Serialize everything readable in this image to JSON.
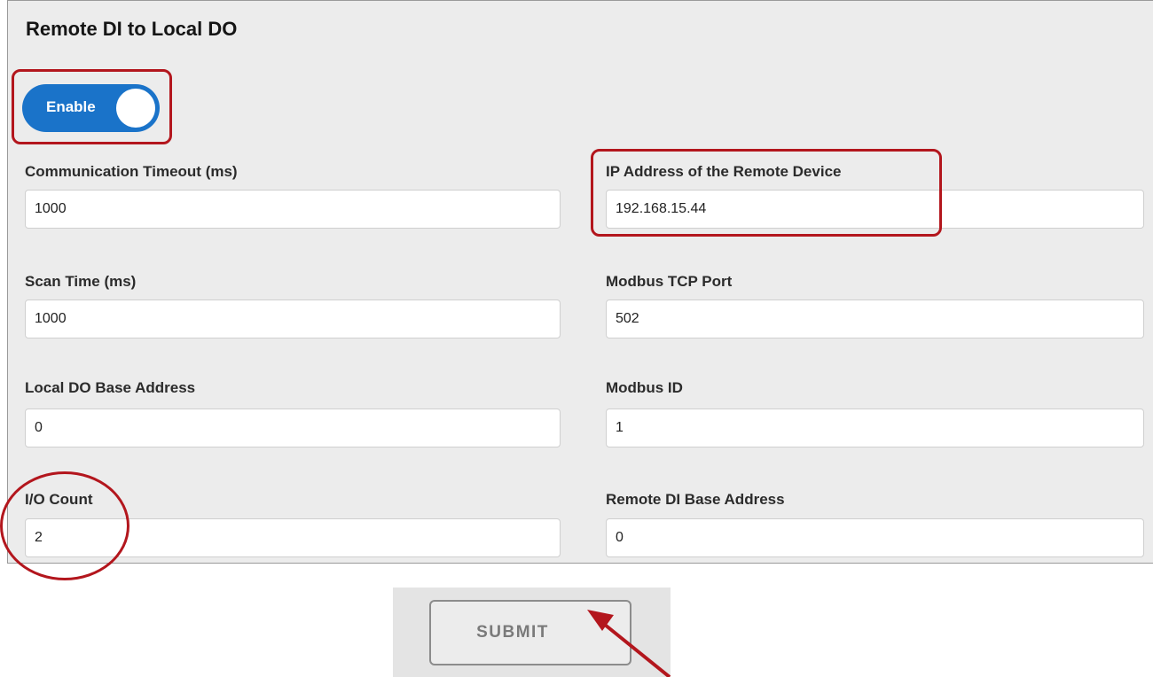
{
  "section": {
    "title": "Remote DI to Local DO"
  },
  "toggle": {
    "label": "Enable",
    "state": "on"
  },
  "fields": {
    "comm_timeout": {
      "label": "Communication Timeout (ms)",
      "value": "1000"
    },
    "ip_address": {
      "label": "IP Address of the Remote Device",
      "value": "192.168.15.44"
    },
    "scan_time": {
      "label": "Scan Time (ms)",
      "value": "1000"
    },
    "modbus_port": {
      "label": "Modbus TCP Port",
      "value": "502"
    },
    "local_do_base": {
      "label": "Local DO Base Address",
      "value": "0"
    },
    "modbus_id": {
      "label": "Modbus ID",
      "value": "1"
    },
    "io_count": {
      "label": "I/O Count",
      "value": "2"
    },
    "remote_di_base": {
      "label": "Remote DI Base Address",
      "value": "0"
    }
  },
  "submit": {
    "label": "SUBMIT"
  },
  "colors": {
    "accent": "#1a73c9",
    "annotation": "#b3161d",
    "panel_background": "#ececec"
  }
}
